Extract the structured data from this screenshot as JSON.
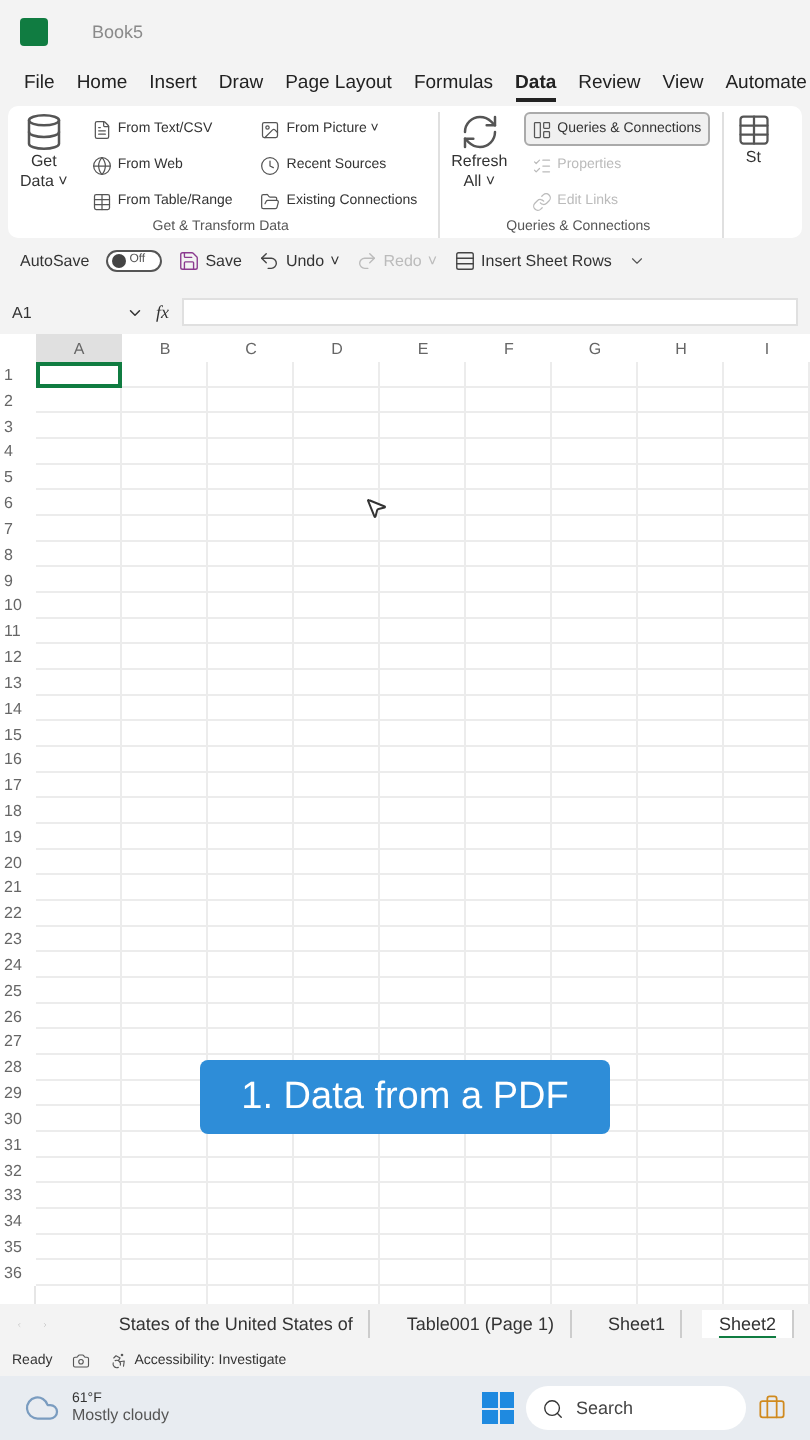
{
  "window": {
    "title": "Book5"
  },
  "menu_tabs": [
    {
      "label": "File",
      "selected": false
    },
    {
      "label": "Home",
      "selected": false
    },
    {
      "label": "Insert",
      "selected": false
    },
    {
      "label": "Draw",
      "selected": false
    },
    {
      "label": "Page Layout",
      "selected": false
    },
    {
      "label": "Formulas",
      "selected": false
    },
    {
      "label": "Data",
      "selected": true
    },
    {
      "label": "Review",
      "selected": false
    },
    {
      "label": "View",
      "selected": false
    },
    {
      "label": "Automate",
      "selected": false
    }
  ],
  "ribbon": {
    "get_data": {
      "label": "Get",
      "label_2": "Data",
      "caret": "˅"
    },
    "get_commands": [
      {
        "label": "From Text/CSV",
        "disabled": false
      },
      {
        "label": "From Web",
        "disabled": false
      },
      {
        "label": "From Table/Range",
        "disabled": false
      },
      {
        "label": "From Picture ˅",
        "disabled": false
      },
      {
        "label": "Recent Sources",
        "disabled": false
      },
      {
        "label": "Existing Connections",
        "disabled": false
      }
    ],
    "get_group_label": "Get & Transform Data",
    "refresh": {
      "label": "Refresh",
      "label_2": "All",
      "caret": "˅"
    },
    "query_commands": [
      {
        "label": "Queries & Connections",
        "disabled": false,
        "selected": true
      },
      {
        "label": "Properties",
        "disabled": true,
        "selected": false
      },
      {
        "label": "Edit Links",
        "disabled": true,
        "selected": false
      }
    ],
    "query_group_label": "Queries & Connections",
    "cut_button": "St"
  },
  "quick_access": {
    "autosave_label": "AutoSave",
    "autosave": {
      "on": false,
      "label": "Off"
    },
    "items": [
      {
        "kind": "save",
        "label": "Save",
        "disabled": false
      },
      {
        "kind": "undo",
        "label": "Undo",
        "disabled": false,
        "caret": "˅"
      },
      {
        "kind": "redo",
        "label": "Redo",
        "disabled": true,
        "caret": "˅"
      },
      {
        "kind": "insert",
        "label": "Insert Sheet Rows",
        "disabled": false
      }
    ]
  },
  "formula_bar": {
    "fx": "fx"
  },
  "grid": {
    "columns": [
      "A",
      "B",
      "C",
      "D",
      "E",
      "F",
      "G",
      "H",
      "I"
    ],
    "rows": [
      "1",
      "2",
      "3",
      "4",
      "5",
      "6",
      "7",
      "8",
      "9",
      "10",
      "11",
      "12",
      "13",
      "14",
      "15",
      "16",
      "17",
      "18",
      "19",
      "20",
      "21",
      "22",
      "23",
      "24",
      "25",
      "26",
      "27",
      "28",
      "29",
      "30",
      "31",
      "32",
      "33",
      "34",
      "35",
      "36"
    ],
    "selected_cell": "A1"
  },
  "caption": "1. Data from a PDF",
  "sheet_tabs": [
    {
      "label": "States of the United States of",
      "selected": false
    },
    {
      "label": "Table001 (Page 1)",
      "selected": false
    },
    {
      "label": "Sheet1",
      "selected": false
    },
    {
      "label": "Sheet2",
      "selected": true
    }
  ],
  "status_bar": {
    "mode": "Ready",
    "accessibility": "Accessibility: Investigate"
  },
  "taskbar": {
    "temperature": "61°F",
    "weather": "Mostly cloudy",
    "search_placeholder": "Search"
  }
}
